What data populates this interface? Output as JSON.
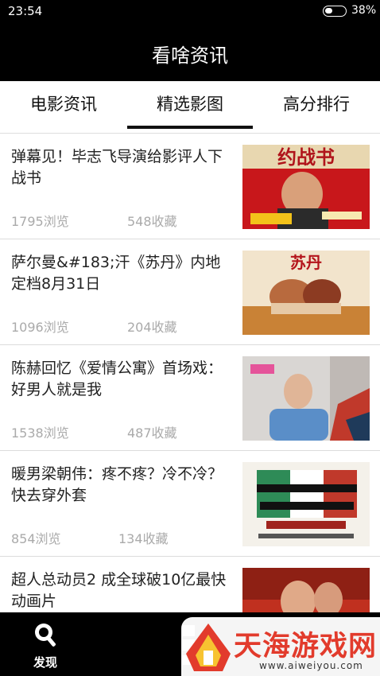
{
  "status_bar": {
    "time": "23:54",
    "battery_percent": "38%",
    "battery_level": 0.38
  },
  "app": {
    "title": "看啥资讯"
  },
  "tabs": [
    {
      "label": "电影资讯",
      "active": false
    },
    {
      "label": "精选影图",
      "active": true
    },
    {
      "label": "高分排行",
      "active": false
    }
  ],
  "articles": [
    {
      "title": "弹幕见！毕志飞导演给影评人下战书",
      "views": "1795浏览",
      "favorites": "548收藏",
      "thumbnail": "movie-poster",
      "thumbnail_text": "约战书"
    },
    {
      "title": "萨尔曼&#183;汗《苏丹》内地定档8月31日",
      "views": "1096浏览",
      "favorites": "204收藏",
      "thumbnail": "movie-poster",
      "thumbnail_text": "苏丹"
    },
    {
      "title": "陈赫回忆《爱情公寓》首场戏：好男人就是我",
      "views": "1538浏览",
      "favorites": "487收藏",
      "thumbnail": "interview-still"
    },
    {
      "title": "暖男梁朝伟：疼不疼？冷不冷？快去穿外套",
      "views": "854浏览",
      "favorites": "134收藏",
      "thumbnail": "movie-poster"
    },
    {
      "title": "超人总动员2  成全球破10亿最快动画片",
      "views": "",
      "favorites": "",
      "thumbnail": "movie-still"
    }
  ],
  "bottom_nav": {
    "discover_label": "发现"
  },
  "watermark": {
    "text": "天海游戏网",
    "url": "www.aiweiyou.com"
  },
  "colors": {
    "bar": "#000000",
    "text": "#222222",
    "meta": "#aaaaaa",
    "watermark": "#e23b2c"
  }
}
